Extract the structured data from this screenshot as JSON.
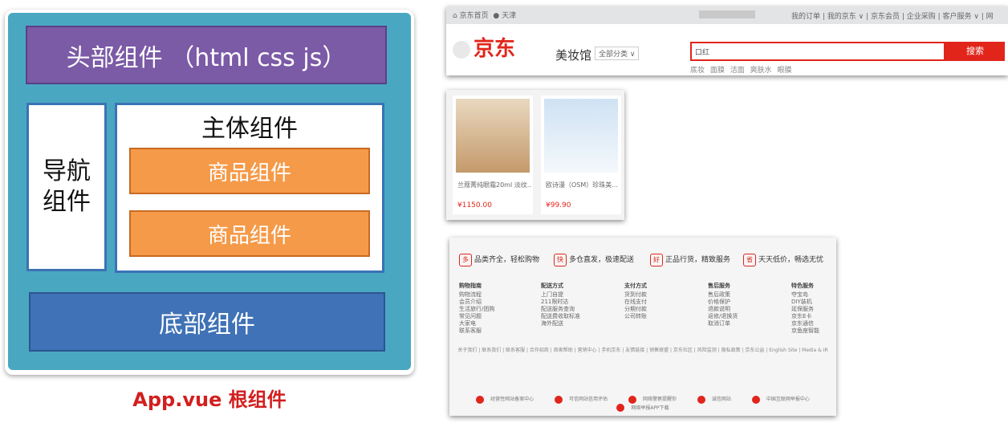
{
  "diagram": {
    "header": "头部组件 （html css js）",
    "nav": "导航组件",
    "main_title": "主体组件",
    "product1": "商品组件",
    "product2": "商品组件",
    "footer": "底部组件",
    "caption": "App.vue 根组件"
  },
  "shot_header": {
    "location": "京东首页",
    "city": "天津",
    "top_links": "我的订单 | 我的京东 ∨ | 京东会员 | 企业采购 | 客户服务 ∨ | 网",
    "logo": "京东",
    "site_category": "美妆馆",
    "category_select": "全部分类",
    "search_value": "口红",
    "search_button": "搜索",
    "hot_words": "底妆 面膜 洁面 爽肤水 眼膜"
  },
  "shot_products": {
    "items": [
      {
        "name": "兰蔻菁纯眼霜20ml 淡纹...",
        "price": "¥1150.00"
      },
      {
        "name": "欧诗漫（OSM）珍珠美...",
        "price": "¥99.90"
      }
    ]
  },
  "shot_footer": {
    "promises": [
      {
        "icon": "多",
        "text": "品类齐全，轻松购物"
      },
      {
        "icon": "快",
        "text": "多仓直发，极速配送"
      },
      {
        "icon": "好",
        "text": "正品行货，精致服务"
      },
      {
        "icon": "省",
        "text": "天天低价，畅选无忧"
      }
    ],
    "columns": [
      {
        "head": "购物指南",
        "items": [
          "购物流程",
          "会员介绍",
          "生活旅行/团购",
          "常见问题",
          "大家电",
          "联系客服"
        ]
      },
      {
        "head": "配送方式",
        "items": [
          "上门自提",
          "211限时达",
          "配送服务查询",
          "配送费收取标准",
          "海外配送"
        ]
      },
      {
        "head": "支付方式",
        "items": [
          "货到付款",
          "在线支付",
          "分期付款",
          "公司转账"
        ]
      },
      {
        "head": "售后服务",
        "items": [
          "售后政策",
          "价格保护",
          "退款说明",
          "返修/退换货",
          "取消订单"
        ]
      },
      {
        "head": "特色服务",
        "items": [
          "夺宝岛",
          "DIY装机",
          "延保服务",
          "京东E卡",
          "京东通信",
          "京鱼座智能"
        ]
      }
    ],
    "links": "关于我们 | 联系我们 | 联系客服 | 合作招商 | 商家帮助 | 营销中心 | 手机京东 | 友情链接 | 销售联盟 | 京东社区 | 风险监测 | 隐私政策 | 京东公益 | English Site | Media & IR",
    "badges": [
      "经营性网站备案中心",
      "可信网站信用评估",
      "网络警察提醒你",
      "诚信网站",
      "中国互联网举报中心",
      "网络举报APP下载"
    ]
  }
}
